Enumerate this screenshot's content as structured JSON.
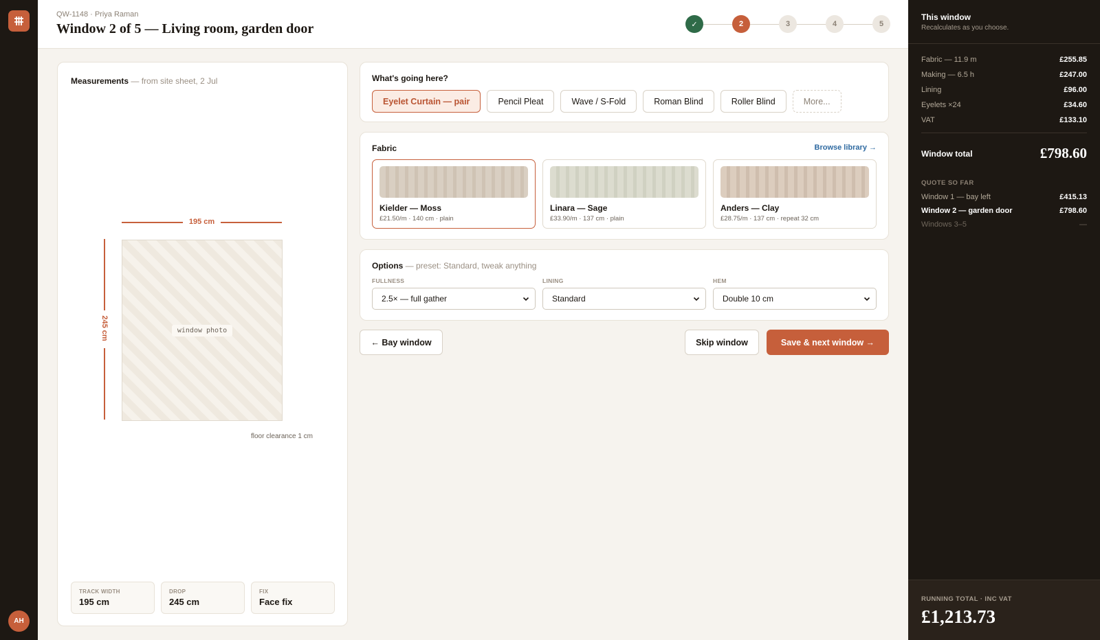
{
  "header": {
    "ref": "QW-1148 · Priya Raman",
    "title": "Window 2 of 5 — Living room, garden door",
    "steps": [
      {
        "label": "✓",
        "state": "done"
      },
      {
        "label": "2",
        "state": "current"
      },
      {
        "label": "3",
        "state": "todo"
      },
      {
        "label": "4",
        "state": "todo"
      },
      {
        "label": "5",
        "state": "todo"
      }
    ]
  },
  "user": {
    "initials": "AH"
  },
  "measurements": {
    "title": "Measurements",
    "subtitle": "— from site sheet, 2 Jul",
    "width_label": "195 cm",
    "drop_label": "245 cm",
    "photo_placeholder": "window photo",
    "clearance": "floor clearance 1 cm",
    "stats": [
      {
        "key": "TRACK WIDTH",
        "value": "195 cm"
      },
      {
        "key": "DROP",
        "value": "245 cm"
      },
      {
        "key": "FIX",
        "value": "Face fix"
      }
    ]
  },
  "type_picker": {
    "title": "What's going here?",
    "options": [
      {
        "label": "Eyelet Curtain — pair",
        "selected": true
      },
      {
        "label": "Pencil Pleat",
        "selected": false
      },
      {
        "label": "Wave / S-Fold",
        "selected": false
      },
      {
        "label": "Roman Blind",
        "selected": false
      },
      {
        "label": "Roller Blind",
        "selected": false
      }
    ],
    "more_label": "More..."
  },
  "fabric": {
    "title": "Fabric",
    "browse_label": "Browse library →",
    "swatches": [
      {
        "name": "Kielder — Moss",
        "meta": "£21.50/m · 140 cm · plain",
        "selected": true,
        "color_a": "#d9cfc2",
        "color_b": "#cfc3b4"
      },
      {
        "name": "Linara — Sage",
        "meta": "£33.90/m · 137 cm · plain",
        "selected": false,
        "color_a": "#dcdccf",
        "color_b": "#d0d1c2"
      },
      {
        "name": "Anders — Clay",
        "meta": "£28.75/m · 137 cm · repeat 32 cm",
        "selected": false,
        "color_a": "#dccdbe",
        "color_b": "#cfbeae"
      }
    ]
  },
  "options": {
    "title": "Options",
    "subtitle": "— preset: Standard, tweak anything",
    "fullness": {
      "label": "FULLNESS",
      "value": "2.5× — full gather"
    },
    "lining": {
      "label": "LINING",
      "value": "Standard"
    },
    "hem": {
      "label": "HEM",
      "value": "Double 10 cm"
    }
  },
  "actions": {
    "back": "← Bay window",
    "skip": "Skip window",
    "next": "Save & next window →"
  },
  "summary": {
    "title": "This window",
    "subtitle": "Recalculates as you choose.",
    "items": [
      {
        "label": "Fabric — 11.9 m",
        "value": "£255.85"
      },
      {
        "label": "Making — 6.5 h",
        "value": "£247.00"
      },
      {
        "label": "Lining",
        "value": "£96.00"
      },
      {
        "label": "Eyelets ×24",
        "value": "£34.60"
      },
      {
        "label": "VAT",
        "value": "£133.10"
      }
    ],
    "window_total_label": "Window total",
    "window_total_value": "£798.60",
    "quote_title": "QUOTE SO FAR",
    "quote_rows": [
      {
        "label": "Window 1 — bay left",
        "value": "£415.13",
        "state": "normal"
      },
      {
        "label": "Window 2 — garden door",
        "value": "£798.60",
        "state": "current"
      },
      {
        "label": "Windows 3–5",
        "value": "—",
        "state": "muted"
      }
    ],
    "running_label": "RUNNING TOTAL · INC VAT",
    "running_value": "£1,213.73"
  },
  "colors": {
    "accent": "#c65f3b",
    "success": "#2f6b48",
    "dark_panel": "#1d1813",
    "link": "#2f6aa1"
  }
}
